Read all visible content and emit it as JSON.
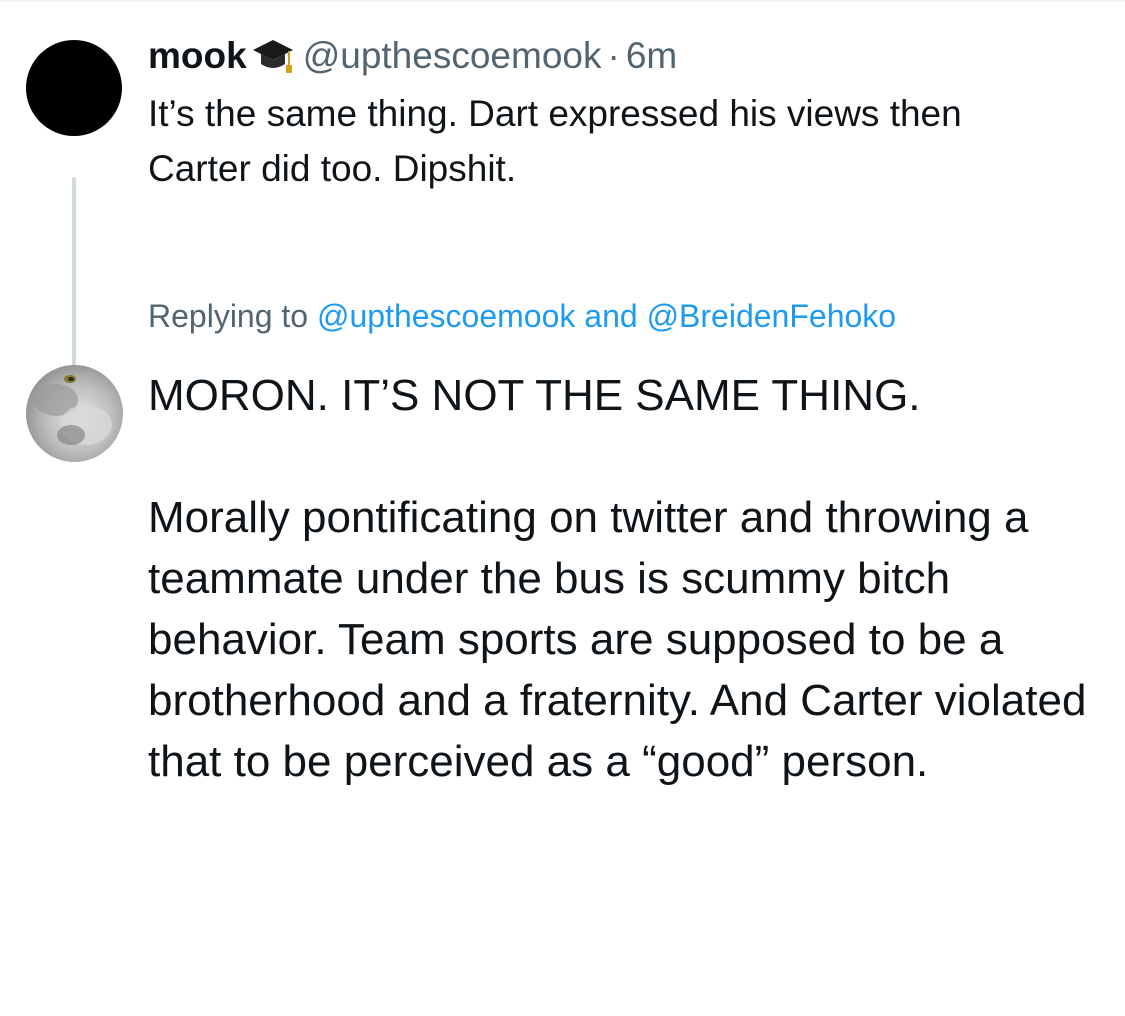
{
  "parent_tweet": {
    "display_name": "mook",
    "badge_icon": "graduation-cap-icon",
    "handle": "@upthescoemook",
    "separator": "·",
    "time": "6m",
    "text": "It’s the same thing. Dart expressed his views then Carter did too. Dipshit."
  },
  "reply": {
    "replying_prefix": "Replying to",
    "mention_1": "@upthescoemook",
    "conjunction": "and",
    "mention_2": "@BreidenFehoko",
    "paragraph_1": "MORON. IT’S NOT THE SAME THING.",
    "paragraph_2": "Morally pontificating on twitter and throwing a teammate under the bus is scummy bitch behavior. Team sports are supposed to be a brotherhood and a fraternity. And Carter violated that to be perceived as a “good” person."
  },
  "colors": {
    "text_primary": "#0f1419",
    "text_secondary": "#536471",
    "link": "#1d9bf0",
    "thread_line": "#cfd9de"
  }
}
